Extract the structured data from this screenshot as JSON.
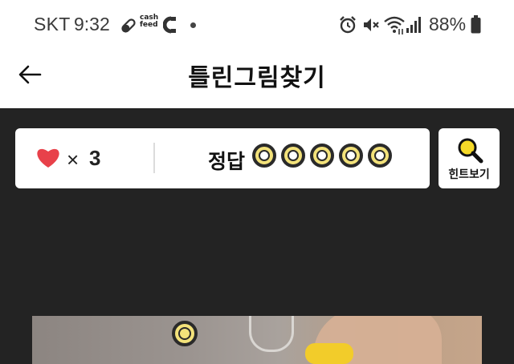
{
  "status_bar": {
    "carrier": "SKT",
    "time": "9:32",
    "cashfeed_text": "cash feed",
    "battery_percent": "88%",
    "icons": [
      "pill-icon",
      "cashfeed-icon",
      "magnet-icon",
      "notification-dot-icon",
      "alarm-icon",
      "mute-icon",
      "wifi-icon",
      "signal-icon",
      "battery-icon"
    ]
  },
  "app_bar": {
    "title": "틀린그림찾기",
    "back_icon": "arrow-left-icon"
  },
  "game_status": {
    "lives_symbol": "×",
    "lives": "3",
    "answer_label": "정답",
    "answers_total": 5,
    "colors": {
      "heart": "#e8414a",
      "ring_fill": "#f3e27a",
      "ring_stroke": "#2a2a2a"
    }
  },
  "hint": {
    "label": "힌트보기",
    "icon": "magnifier-icon"
  },
  "theme": {
    "background": "#232323",
    "panel": "#ffffff"
  }
}
